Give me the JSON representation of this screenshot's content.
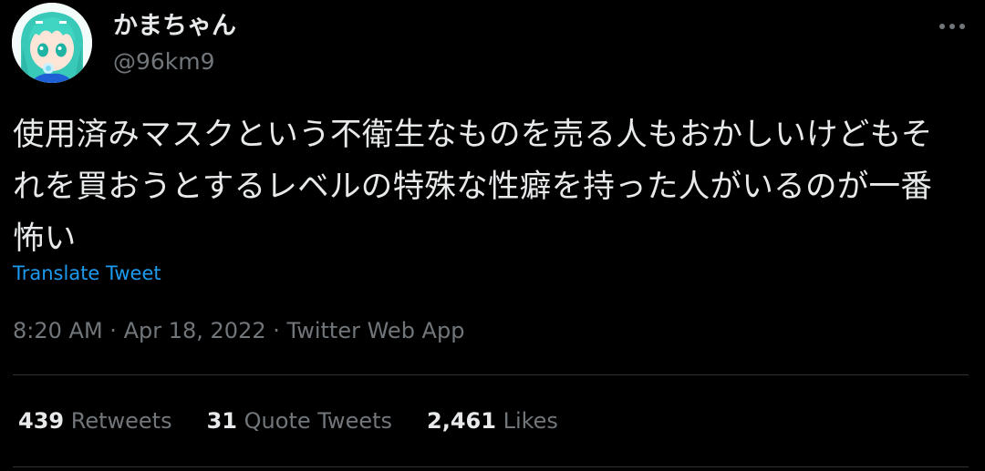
{
  "author": {
    "display_name": "かまちゃん",
    "handle": "@96km9"
  },
  "tweet": {
    "text": "使用済みマスクという不衛生なものを売る人もおかしいけどもそれを買おうとするレベルの特殊な性癖を持った人がいるのが一番怖い",
    "translate_label": "Translate Tweet"
  },
  "meta": {
    "time": "8:20 AM",
    "separator": "·",
    "date": "Apr 18, 2022",
    "source": "Twitter Web App"
  },
  "stats": {
    "retweets_count": "439",
    "retweets_label": "Retweets",
    "quotes_count": "31",
    "quotes_label": "Quote Tweets",
    "likes_count": "2,461",
    "likes_label": "Likes"
  },
  "icons": {
    "more": "more-dots-icon",
    "avatar": "anime-avatar"
  },
  "colors": {
    "background": "#000000",
    "text_primary": "#e7e9ea",
    "text_secondary": "#71767b",
    "link": "#1d9bf0",
    "divider": "#2f3336"
  }
}
